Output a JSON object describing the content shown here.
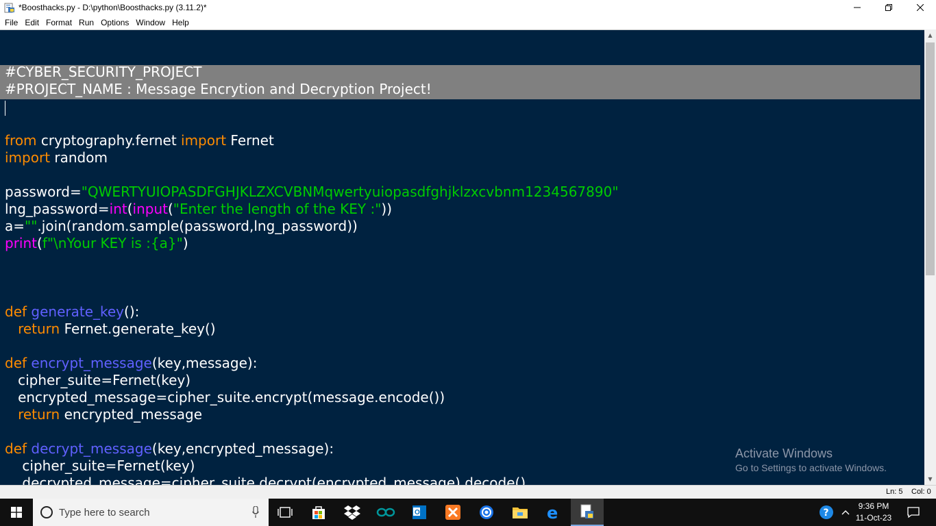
{
  "window": {
    "title": "*Boosthacks.py - D:\\python\\Boosthacks.py (3.11.2)*",
    "controls": [
      "—",
      "❐",
      "✕"
    ]
  },
  "menu": [
    {
      "hot": "F",
      "rest": "ile"
    },
    {
      "hot": "E",
      "rest": "dit"
    },
    {
      "hot": "",
      "pre": "F",
      "hot2": "o",
      "rest": "rmat"
    },
    {
      "hot": "R",
      "rest": "un"
    },
    {
      "hot": "O",
      "rest": "ptions"
    },
    {
      "hot": "W",
      "rest": "indow"
    },
    {
      "hot": "H",
      "rest": "elp"
    }
  ],
  "menu_labels": [
    "File",
    "Edit",
    "Format",
    "Run",
    "Options",
    "Window",
    "Help"
  ],
  "colors": {
    "editor_bg": "#002240",
    "keyword": "#ff8c00",
    "builtin": "#ff00ff",
    "string": "#00cc00",
    "definition": "#6060ff",
    "default": "#ffffff",
    "selection": "#808080"
  },
  "code_lines": [
    [
      {
        "t": "#CYBER_SECURITY_PROJECT",
        "c": "w"
      }
    ],
    [
      {
        "t": "#PROJECT_NAME : Message Encrytion and Decryption Project!",
        "c": "w"
      }
    ],
    [],
    [],
    [
      {
        "t": "from",
        "c": "k"
      },
      {
        "t": " cryptography.fernet ",
        "c": "w"
      },
      {
        "t": "import",
        "c": "k"
      },
      {
        "t": " Fernet",
        "c": "w"
      }
    ],
    [
      {
        "t": "import",
        "c": "k"
      },
      {
        "t": " random",
        "c": "w"
      }
    ],
    [],
    [
      {
        "t": "password=",
        "c": "w"
      },
      {
        "t": "\"QWERTYUIOPASDFGHJKLZXCVBNMqwertyuiopasdfghjklzxcvbnm1234567890\"",
        "c": "s"
      }
    ],
    [
      {
        "t": "lng_password=",
        "c": "w"
      },
      {
        "t": "int",
        "c": "b"
      },
      {
        "t": "(",
        "c": "w"
      },
      {
        "t": "input",
        "c": "b"
      },
      {
        "t": "(",
        "c": "w"
      },
      {
        "t": "\"Enter the length of the KEY :\"",
        "c": "s"
      },
      {
        "t": "))",
        "c": "w"
      }
    ],
    [
      {
        "t": "a=",
        "c": "w"
      },
      {
        "t": "\"\"",
        "c": "s"
      },
      {
        "t": ".join(random.sample(password,lng_password))",
        "c": "w"
      }
    ],
    [
      {
        "t": "print",
        "c": "b"
      },
      {
        "t": "(",
        "c": "w"
      },
      {
        "t": "f\"\\nYour KEY is :{a}\"",
        "c": "s"
      },
      {
        "t": ")",
        "c": "w"
      }
    ],
    [],
    [],
    [],
    [
      {
        "t": "def",
        "c": "k"
      },
      {
        "t": " ",
        "c": "w"
      },
      {
        "t": "generate_key",
        "c": "f"
      },
      {
        "t": "():",
        "c": "w"
      }
    ],
    [
      {
        "t": "   ",
        "c": "w"
      },
      {
        "t": "return",
        "c": "k"
      },
      {
        "t": " Fernet.generate_key()",
        "c": "w"
      }
    ],
    [],
    [
      {
        "t": "def",
        "c": "k"
      },
      {
        "t": " ",
        "c": "w"
      },
      {
        "t": "encrypt_message",
        "c": "f"
      },
      {
        "t": "(key,message):",
        "c": "w"
      }
    ],
    [
      {
        "t": "   cipher_suite=Fernet(key)",
        "c": "w"
      }
    ],
    [
      {
        "t": "   encrypted_message=cipher_suite.encrypt(message.encode())",
        "c": "w"
      }
    ],
    [
      {
        "t": "   ",
        "c": "w"
      },
      {
        "t": "return",
        "c": "k"
      },
      {
        "t": " encrypted_message",
        "c": "w"
      }
    ],
    [],
    [
      {
        "t": "def",
        "c": "k"
      },
      {
        "t": " ",
        "c": "w"
      },
      {
        "t": "decrypt_message",
        "c": "f"
      },
      {
        "t": "(key,encrypted_message):",
        "c": "w"
      }
    ],
    [
      {
        "t": "    cipher_suite=Fernet(key)",
        "c": "w"
      }
    ],
    [
      {
        "t": "    decrypted_message=cipher_suite.decrypt(encrypted_message).decode()",
        "c": "w"
      }
    ]
  ],
  "watermark": {
    "line1": "Activate Windows",
    "line2": "Go to Settings to activate Windows."
  },
  "status": {
    "ln": "Ln: 5",
    "col": "Col: 0"
  },
  "taskbar": {
    "search_placeholder": "Type here to search",
    "pinned": [
      "task-view-icon",
      "store-icon",
      "dropbox-icon",
      "arduino-icon",
      "outlook-icon",
      "xampp-icon",
      "browser-icon",
      "file-explorer-icon",
      "edge-icon",
      "python-idle-icon"
    ],
    "time": "9:36 PM",
    "date": "11-Oct-23"
  }
}
